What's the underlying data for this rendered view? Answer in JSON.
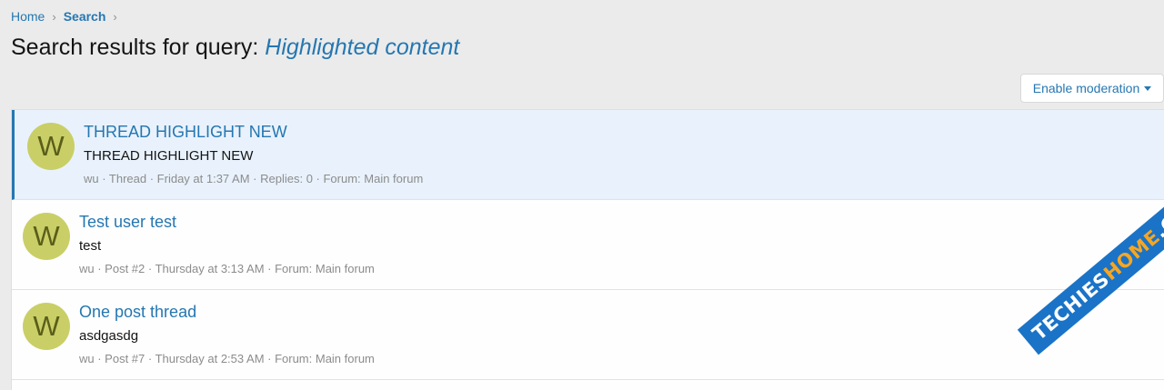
{
  "breadcrumb": {
    "home": "Home",
    "separator": "›",
    "current": "Search"
  },
  "page": {
    "title_prefix": "Search results for query: ",
    "query": "Highlighted content"
  },
  "moderation": {
    "label": "Enable moderation"
  },
  "results": [
    {
      "avatar_letter": "W",
      "title": "THREAD HIGHLIGHT NEW",
      "snippet": "THREAD HIGHLIGHT NEW",
      "meta": "wu · Thread · Friday at 1:37 AM · Replies: 0 · Forum: Main forum",
      "highlighted": true
    },
    {
      "avatar_letter": "W",
      "title": "Test user test",
      "snippet": "test",
      "meta": "wu · Post #2 · Thursday at 3:13 AM · Forum: Main forum",
      "highlighted": false
    },
    {
      "avatar_letter": "W",
      "title": "One post thread",
      "snippet": "asdgasdg",
      "meta": "wu · Post #7 · Thursday at 2:53 AM · Forum: Main forum",
      "highlighted": false
    }
  ],
  "watermark": {
    "part1": "TECHIES",
    "part2": "HOME",
    "part3": ".COM"
  },
  "colors": {
    "link": "#2577b1",
    "highlight_bg": "#e9f2fc",
    "avatar_bg": "#c9cf66"
  }
}
